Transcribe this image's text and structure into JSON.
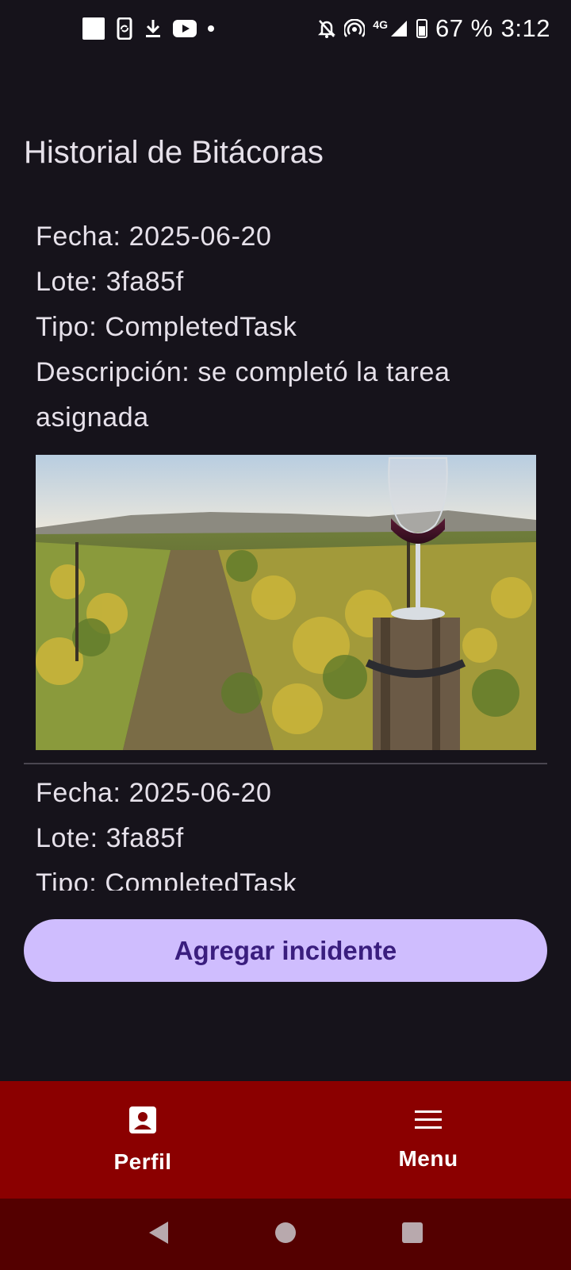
{
  "status_bar": {
    "battery": "67 %",
    "time": "3:12",
    "network": "4G",
    "left_icons": [
      "square-notification-icon",
      "phone-sync-icon",
      "download-icon",
      "youtube-icon",
      "dot-icon"
    ],
    "right_icons": [
      "bell-off-icon",
      "hotspot-icon",
      "signal-icon",
      "battery-icon"
    ]
  },
  "page": {
    "title": "Historial de Bitácoras"
  },
  "entries": [
    {
      "date_label": "Fecha: 2025-06-20",
      "lot_label": "Lote: 3fa85f",
      "type_label": "Tipo: CompletedTask",
      "description_label": "Descripción: se completó la tarea asignada",
      "image_alt": "vineyard-photo"
    },
    {
      "date_label": "Fecha: 2025-06-20",
      "lot_label": "Lote: 3fa85f",
      "type_label": "Tipo: CompletedTask"
    }
  ],
  "actions": {
    "add_incident": "Agregar incidente"
  },
  "bottom_nav": {
    "items": [
      {
        "label": "Perfil",
        "icon": "profile-icon"
      },
      {
        "label": "Menu",
        "icon": "menu-icon"
      }
    ]
  },
  "colors": {
    "background": "#16131b",
    "button": "#cfbdfe",
    "button_text": "#3a1e7e",
    "nav": "#8b0000",
    "system_nav": "#540000"
  }
}
